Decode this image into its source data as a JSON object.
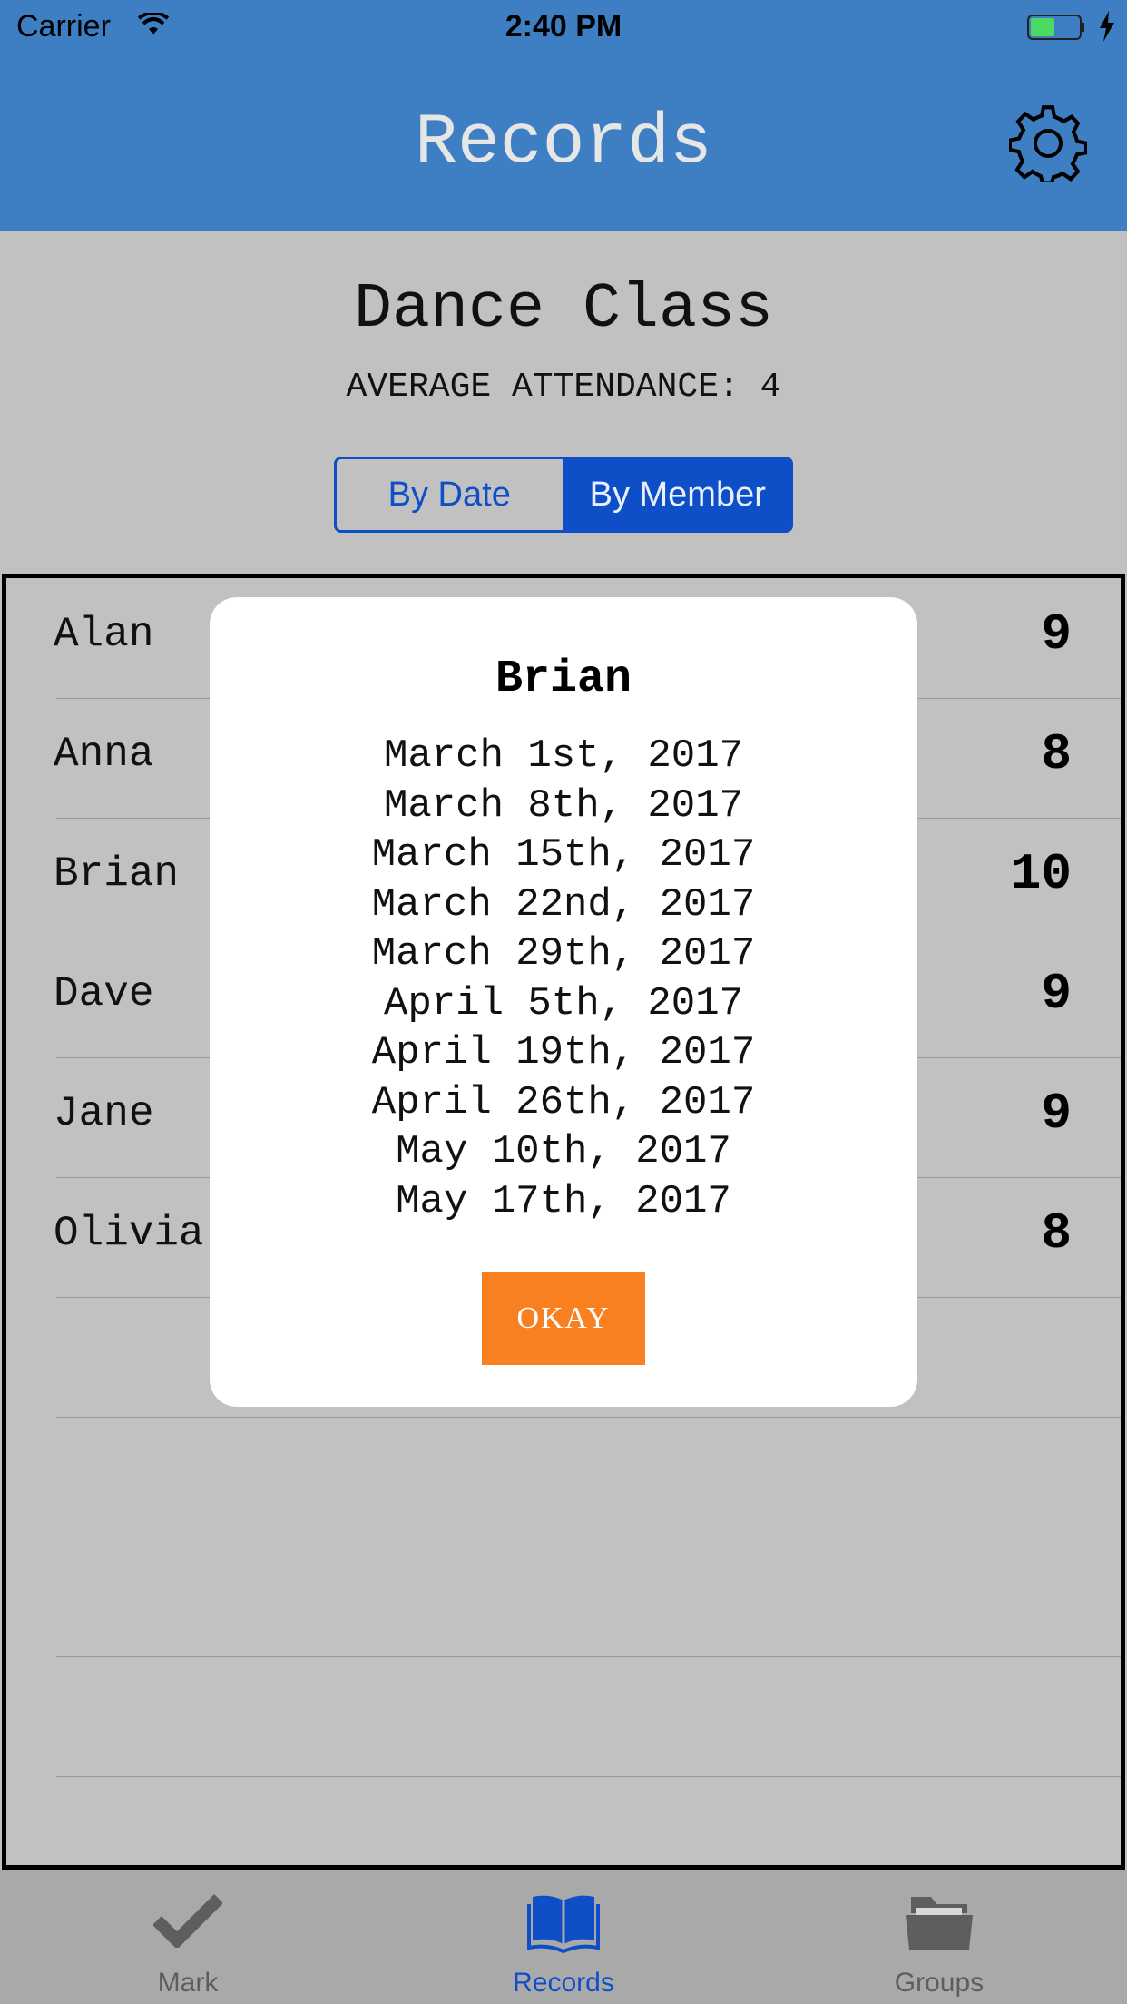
{
  "status_bar": {
    "carrier": "Carrier",
    "time": "2:40 PM"
  },
  "nav": {
    "title": "Records",
    "settings_icon": "gear-icon"
  },
  "group": {
    "name": "Dance Class",
    "average_label": "AVERAGE ATTENDANCE:",
    "average_value": "4"
  },
  "segments": [
    {
      "label": "By Date",
      "selected": false
    },
    {
      "label": "By Member",
      "selected": true
    }
  ],
  "members": [
    {
      "name": "Alan",
      "count": "9"
    },
    {
      "name": "Anna",
      "count": "8"
    },
    {
      "name": "Brian",
      "count": "10"
    },
    {
      "name": "Dave",
      "count": "9"
    },
    {
      "name": "Jane",
      "count": "9"
    },
    {
      "name": "Olivia",
      "count": "8"
    }
  ],
  "modal": {
    "title": "Brian",
    "dates": [
      "March 1st, 2017",
      "March 8th, 2017",
      "March 15th, 2017",
      "March 22nd, 2017",
      "March 29th, 2017",
      "April 5th, 2017",
      "April 19th, 2017",
      "April 26th, 2017",
      "May 10th, 2017",
      "May 17th, 2017"
    ],
    "button": "OKAY"
  },
  "tabs": [
    {
      "label": "Mark",
      "icon": "checkmark-icon",
      "selected": false
    },
    {
      "label": "Records",
      "icon": "book-icon",
      "selected": true
    },
    {
      "label": "Groups",
      "icon": "folder-icon",
      "selected": false
    }
  ],
  "colors": {
    "nav": "#3e7ec3",
    "accent": "#0e4fc7",
    "button": "#f98020",
    "background": "#c1c1c1"
  }
}
